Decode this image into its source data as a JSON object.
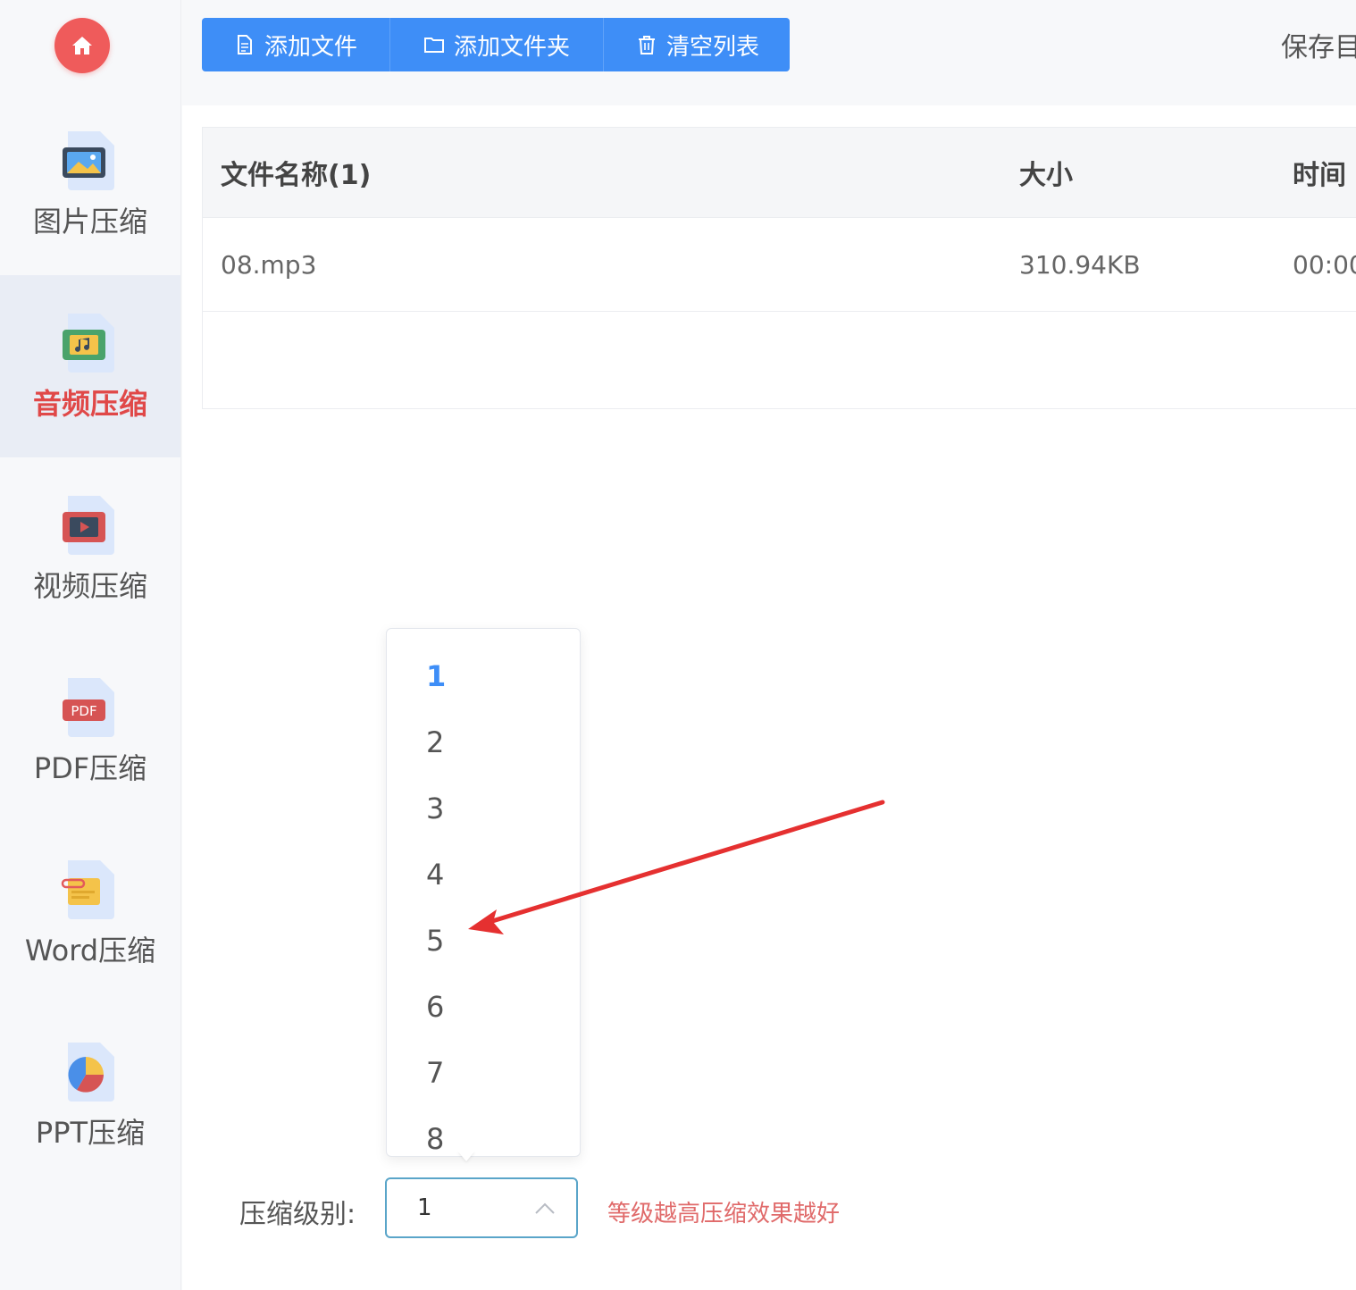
{
  "sidebar": {
    "items": [
      {
        "label": "图片压缩",
        "icon": "image-file-icon"
      },
      {
        "label": "音频压缩",
        "icon": "audio-file-icon"
      },
      {
        "label": "视频压缩",
        "icon": "video-file-icon"
      },
      {
        "label": "PDF压缩",
        "icon": "pdf-file-icon"
      },
      {
        "label": "Word压缩",
        "icon": "word-file-icon"
      },
      {
        "label": "PPT压缩",
        "icon": "ppt-file-icon"
      }
    ],
    "active_index": 1
  },
  "toolbar": {
    "add_file": "添加文件",
    "add_folder": "添加文件夹",
    "clear_list": "清空列表",
    "save_text": "保存目"
  },
  "table": {
    "headers": {
      "name": "文件名称(1)",
      "size": "大小",
      "time": "时间"
    },
    "rows": [
      {
        "name": "08.mp3",
        "size": "310.94KB",
        "time": "00:00"
      }
    ]
  },
  "settings": {
    "level_label": "压缩级别:",
    "level_value": "1",
    "hint": "等级越高压缩效果越好"
  },
  "dropdown": {
    "options": [
      "1",
      "2",
      "3",
      "4",
      "5",
      "6",
      "7",
      "8"
    ],
    "selected": "1"
  },
  "colors": {
    "accent": "#3e8ef7",
    "active_nav": "#e04848",
    "home": "#ef5b5b",
    "arrow": "#e53030"
  }
}
